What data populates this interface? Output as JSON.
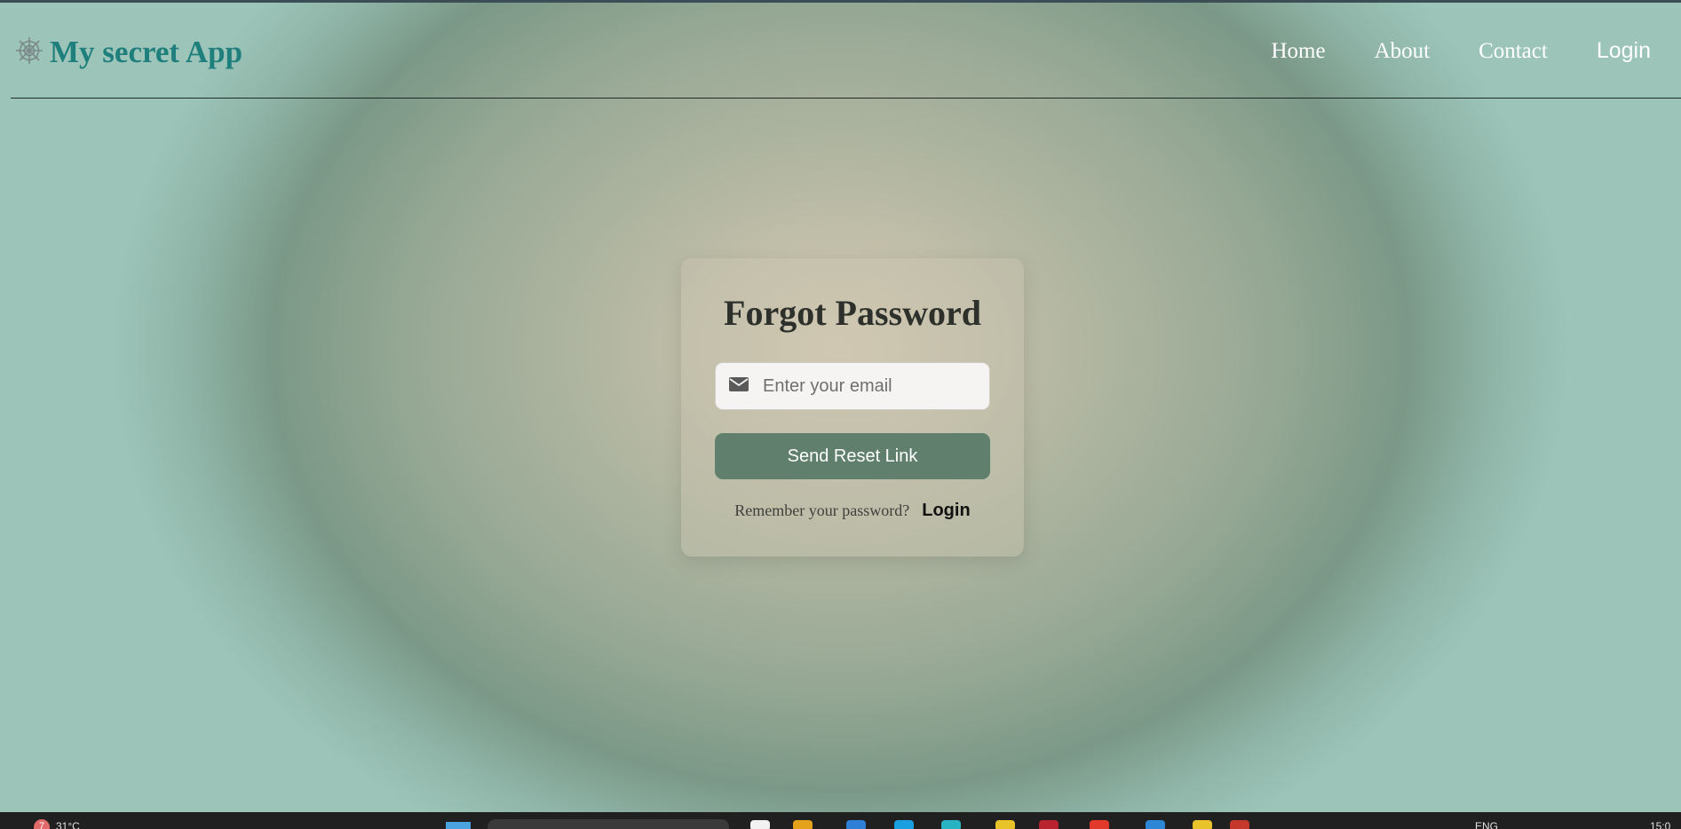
{
  "header": {
    "brand_name": "My secret App",
    "brand_icon": "spider-web-icon",
    "nav": {
      "home": "Home",
      "about": "About",
      "contact": "Contact",
      "login": "Login"
    }
  },
  "card": {
    "title": "Forgot Password",
    "email_placeholder": "Enter your email",
    "email_icon": "envelope-icon",
    "submit_label": "Send Reset Link",
    "remember_text": "Remember your password?",
    "login_link": "Login"
  },
  "taskbar": {
    "notification_count": "7",
    "temperature": "31°C",
    "language": "ENG",
    "clock": "15:0"
  },
  "colors": {
    "brand": "#1f7f7d",
    "button": "#607f6d",
    "title": "#2e302c"
  }
}
